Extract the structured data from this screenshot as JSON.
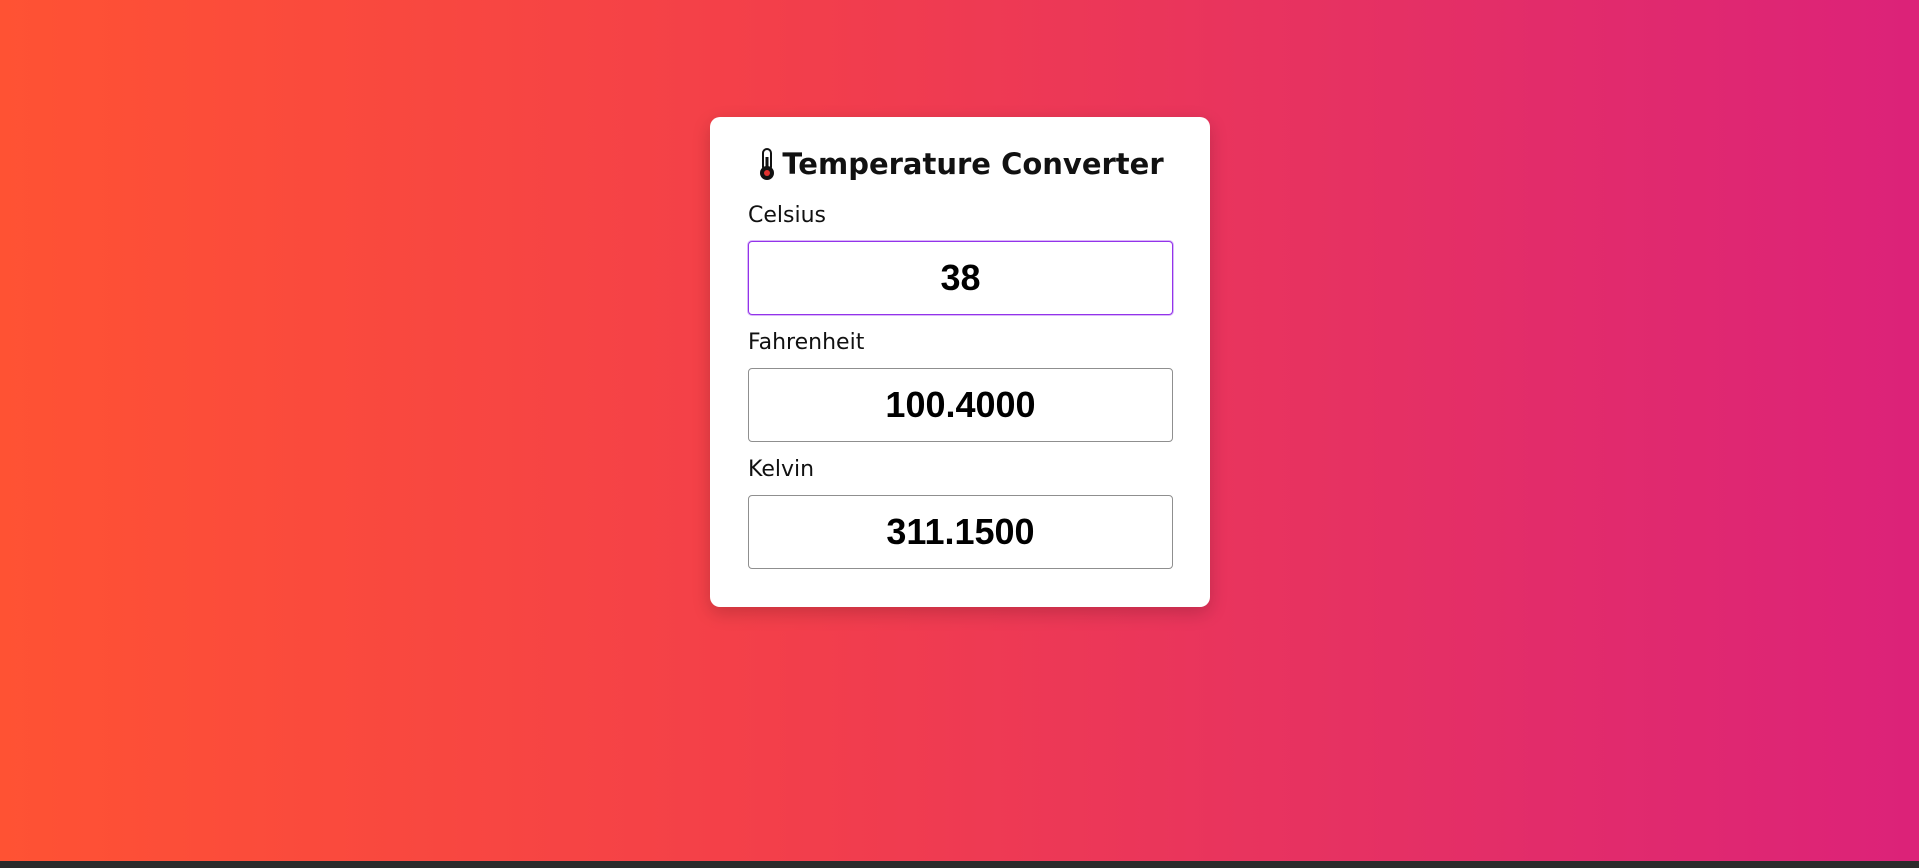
{
  "app": {
    "title": "Temperature Converter",
    "title_icon": "thermometer-icon"
  },
  "fields": {
    "celsius": {
      "label": "Celsius",
      "value": "38"
    },
    "fahrenheit": {
      "label": "Fahrenheit",
      "value": "100.4000"
    },
    "kelvin": {
      "label": "Kelvin",
      "value": "311.1500"
    }
  },
  "colors": {
    "gradient_start": "#ff5233",
    "gradient_end": "#dc2279",
    "focus_border": "#9333ea",
    "card_background": "#ffffff"
  }
}
